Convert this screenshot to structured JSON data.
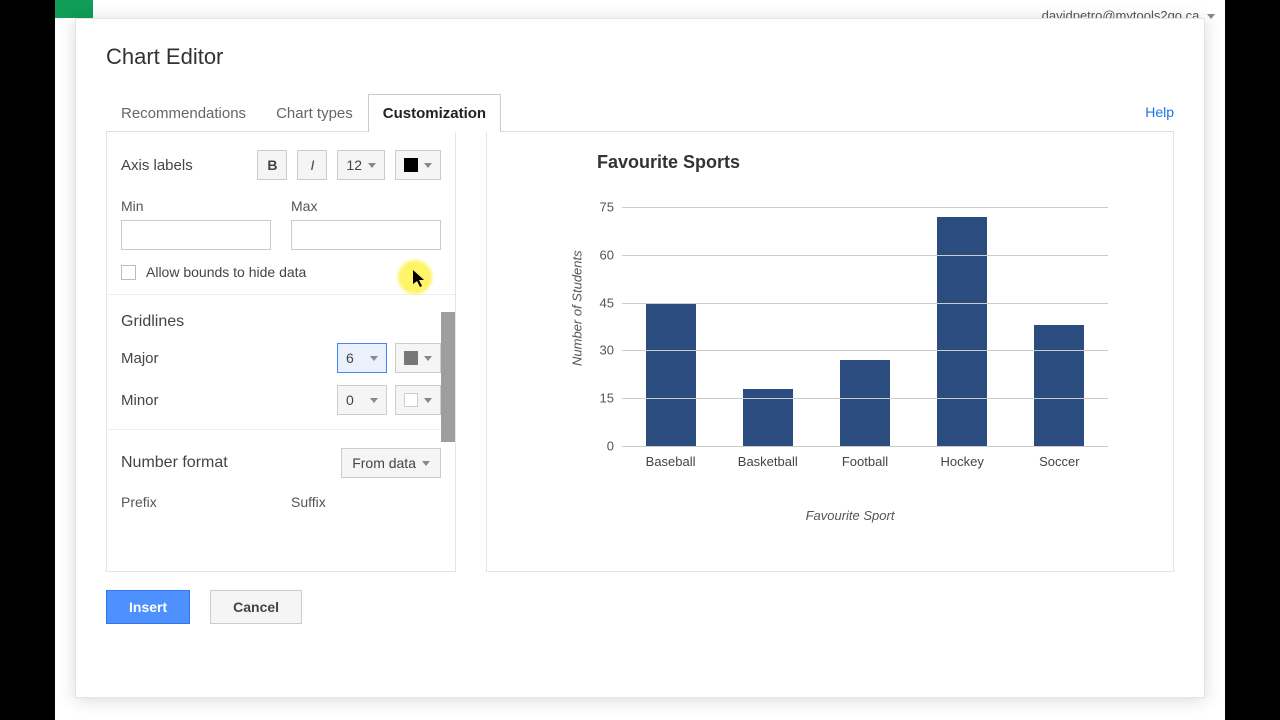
{
  "user_email": "davidpetro@mytools2go.ca",
  "dialog_title": "Chart Editor",
  "tabs": {
    "rec": "Recommendations",
    "types": "Chart types",
    "custom": "Customization"
  },
  "help": "Help",
  "axis": {
    "label": "Axis labels",
    "font_size": "12",
    "min_label": "Min",
    "max_label": "Max",
    "min_value": "",
    "max_value": "",
    "allow_bounds": "Allow bounds to hide data"
  },
  "gridlines": {
    "label": "Gridlines",
    "major_label": "Major",
    "minor_label": "Minor",
    "major_value": "6",
    "minor_value": "0"
  },
  "number_format": {
    "label": "Number format",
    "selector": "From data",
    "prefix_label": "Prefix",
    "suffix_label": "Suffix"
  },
  "buttons": {
    "insert": "Insert",
    "cancel": "Cancel"
  },
  "chart_data": {
    "type": "bar",
    "title": "Favourite Sports",
    "xlabel": "Favourite Sport",
    "ylabel": "Number of Students",
    "ylim": [
      0,
      75
    ],
    "y_ticks": [
      0,
      15,
      30,
      45,
      60,
      75
    ],
    "categories": [
      "Baseball",
      "Basketball",
      "Football",
      "Hockey",
      "Soccer"
    ],
    "values": [
      45,
      18,
      27,
      72,
      38
    ]
  }
}
